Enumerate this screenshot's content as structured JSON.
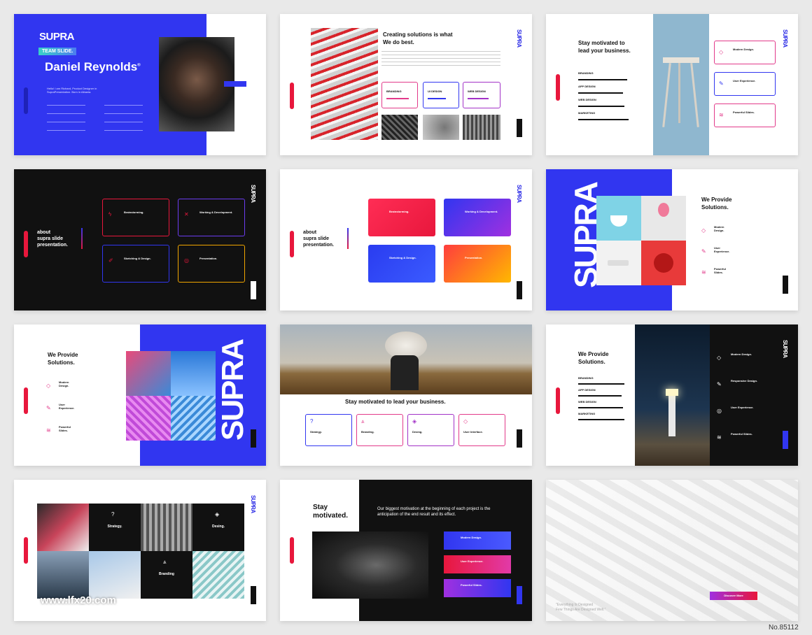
{
  "slide1": {
    "logo": "SUPRA",
    "badge": "TEAM SLIDE.",
    "name": "Daniel Reynolds",
    "reg": "®",
    "bio": "Hello! I am Richard, Product Designer in SupraPresentation. Born in Albania."
  },
  "slide2": {
    "title_line1": "Creating solutions is what",
    "title_line2": "We do best.",
    "cards": [
      "BRANDING",
      "UI DESIGN",
      "WEB DESIGN"
    ]
  },
  "slide3": {
    "title_line1": "Stay motivated to",
    "title_line2": "lead your business.",
    "skills": [
      "BRANDING",
      "APP DESIGN",
      "WEB DESIGN",
      "MARKETING"
    ],
    "features": [
      "Modern Design.",
      "User Experience.",
      "Powerful Slides."
    ]
  },
  "slide4": {
    "title_line1": "about",
    "title_line2": "supra slide",
    "title_line3": "presentation.",
    "cards": [
      "Brainstorming.",
      "Working & Development.",
      "Sketching & Design.",
      "Presentation."
    ]
  },
  "slide5": {
    "title_line1": "about",
    "title_line2": "supra slide",
    "title_line3": "presentation.",
    "cards": [
      "Brainstorming.",
      "Working & Development.",
      "Sketching & Design.",
      "Presentation."
    ]
  },
  "slide6": {
    "logo": "SUPRA",
    "title_line1": "We Provide",
    "title_line2": "Solutions.",
    "features": [
      "Modern Design.",
      "User Experience.",
      "Powerful Slides."
    ]
  },
  "slide7": {
    "logo": "SUPRA",
    "title_line1": "We Provide",
    "title_line2": "Solutions.",
    "features": [
      "Modern Design.",
      "User Experience.",
      "Powerful Slides."
    ]
  },
  "slide8": {
    "title": "Stay motivated to lead your business.",
    "cards": [
      "Strategy.",
      "Branding.",
      "Desing.",
      "User Interface."
    ]
  },
  "slide9": {
    "title_line1": "We Provide",
    "title_line2": "Solutions.",
    "skills": [
      "BRANDING",
      "APP DESIGN",
      "WEB DESIGN",
      "MARKETING"
    ],
    "features": [
      "Modern Design.",
      "Responsive Design.",
      "User Experience.",
      "Powerful Slides."
    ]
  },
  "slide10": {
    "cells": [
      "Strategy.",
      "Desing.",
      "Branding"
    ]
  },
  "slide11": {
    "title_line1": "Stay",
    "title_line2": "motivated.",
    "quote": "Our biggest motivation at the beginning of each project is the anticipation of the end result and its effect.",
    "features": [
      "Modern Design.",
      "User Experience.",
      "Powerful Slides."
    ]
  },
  "slide12": {
    "quote_line1": "\"Everything Is Designed",
    "quote_line2": "Few Things Are Designed Well.\"",
    "button": "Discover More"
  },
  "watermark": "www.lfx20.com",
  "item_no": "No.85112",
  "colors": {
    "blue": "#3136f0",
    "red": "#e8173c",
    "pink": "#e23a8a",
    "dark": "#111111"
  }
}
